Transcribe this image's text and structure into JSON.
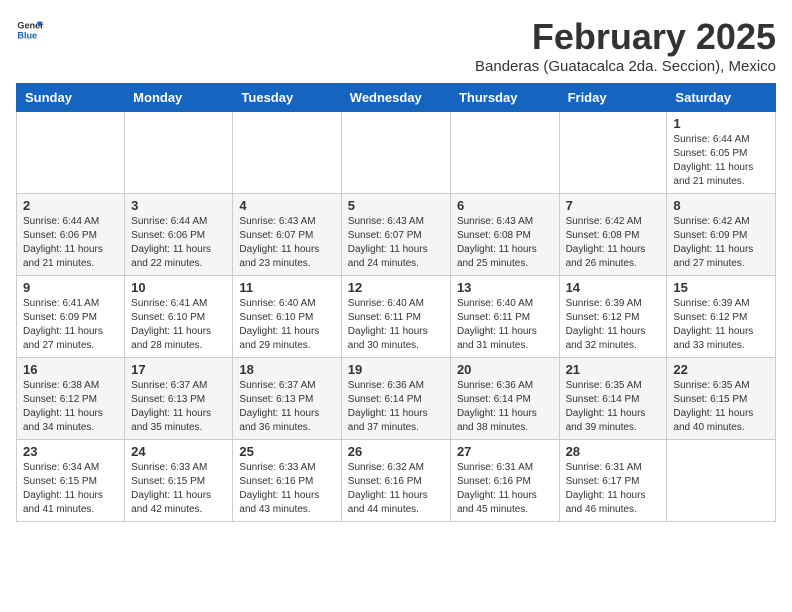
{
  "header": {
    "logo_general": "General",
    "logo_blue": "Blue",
    "title": "February 2025",
    "subtitle": "Banderas (Guatacalca 2da. Seccion), Mexico"
  },
  "weekdays": [
    "Sunday",
    "Monday",
    "Tuesday",
    "Wednesday",
    "Thursday",
    "Friday",
    "Saturday"
  ],
  "weeks": [
    {
      "days": [
        {
          "num": "",
          "empty": true
        },
        {
          "num": "",
          "empty": true
        },
        {
          "num": "",
          "empty": true
        },
        {
          "num": "",
          "empty": true
        },
        {
          "num": "",
          "empty": true
        },
        {
          "num": "",
          "empty": true
        },
        {
          "num": "1",
          "sunrise": "6:44 AM",
          "sunset": "6:05 PM",
          "daylight": "11 hours and 21 minutes."
        }
      ]
    },
    {
      "days": [
        {
          "num": "2",
          "sunrise": "6:44 AM",
          "sunset": "6:06 PM",
          "daylight": "11 hours and 21 minutes."
        },
        {
          "num": "3",
          "sunrise": "6:44 AM",
          "sunset": "6:06 PM",
          "daylight": "11 hours and 22 minutes."
        },
        {
          "num": "4",
          "sunrise": "6:43 AM",
          "sunset": "6:07 PM",
          "daylight": "11 hours and 23 minutes."
        },
        {
          "num": "5",
          "sunrise": "6:43 AM",
          "sunset": "6:07 PM",
          "daylight": "11 hours and 24 minutes."
        },
        {
          "num": "6",
          "sunrise": "6:43 AM",
          "sunset": "6:08 PM",
          "daylight": "11 hours and 25 minutes."
        },
        {
          "num": "7",
          "sunrise": "6:42 AM",
          "sunset": "6:08 PM",
          "daylight": "11 hours and 26 minutes."
        },
        {
          "num": "8",
          "sunrise": "6:42 AM",
          "sunset": "6:09 PM",
          "daylight": "11 hours and 27 minutes."
        }
      ]
    },
    {
      "days": [
        {
          "num": "9",
          "sunrise": "6:41 AM",
          "sunset": "6:09 PM",
          "daylight": "11 hours and 27 minutes."
        },
        {
          "num": "10",
          "sunrise": "6:41 AM",
          "sunset": "6:10 PM",
          "daylight": "11 hours and 28 minutes."
        },
        {
          "num": "11",
          "sunrise": "6:40 AM",
          "sunset": "6:10 PM",
          "daylight": "11 hours and 29 minutes."
        },
        {
          "num": "12",
          "sunrise": "6:40 AM",
          "sunset": "6:11 PM",
          "daylight": "11 hours and 30 minutes."
        },
        {
          "num": "13",
          "sunrise": "6:40 AM",
          "sunset": "6:11 PM",
          "daylight": "11 hours and 31 minutes."
        },
        {
          "num": "14",
          "sunrise": "6:39 AM",
          "sunset": "6:12 PM",
          "daylight": "11 hours and 32 minutes."
        },
        {
          "num": "15",
          "sunrise": "6:39 AM",
          "sunset": "6:12 PM",
          "daylight": "11 hours and 33 minutes."
        }
      ]
    },
    {
      "days": [
        {
          "num": "16",
          "sunrise": "6:38 AM",
          "sunset": "6:12 PM",
          "daylight": "11 hours and 34 minutes."
        },
        {
          "num": "17",
          "sunrise": "6:37 AM",
          "sunset": "6:13 PM",
          "daylight": "11 hours and 35 minutes."
        },
        {
          "num": "18",
          "sunrise": "6:37 AM",
          "sunset": "6:13 PM",
          "daylight": "11 hours and 36 minutes."
        },
        {
          "num": "19",
          "sunrise": "6:36 AM",
          "sunset": "6:14 PM",
          "daylight": "11 hours and 37 minutes."
        },
        {
          "num": "20",
          "sunrise": "6:36 AM",
          "sunset": "6:14 PM",
          "daylight": "11 hours and 38 minutes."
        },
        {
          "num": "21",
          "sunrise": "6:35 AM",
          "sunset": "6:14 PM",
          "daylight": "11 hours and 39 minutes."
        },
        {
          "num": "22",
          "sunrise": "6:35 AM",
          "sunset": "6:15 PM",
          "daylight": "11 hours and 40 minutes."
        }
      ]
    },
    {
      "days": [
        {
          "num": "23",
          "sunrise": "6:34 AM",
          "sunset": "6:15 PM",
          "daylight": "11 hours and 41 minutes."
        },
        {
          "num": "24",
          "sunrise": "6:33 AM",
          "sunset": "6:15 PM",
          "daylight": "11 hours and 42 minutes."
        },
        {
          "num": "25",
          "sunrise": "6:33 AM",
          "sunset": "6:16 PM",
          "daylight": "11 hours and 43 minutes."
        },
        {
          "num": "26",
          "sunrise": "6:32 AM",
          "sunset": "6:16 PM",
          "daylight": "11 hours and 44 minutes."
        },
        {
          "num": "27",
          "sunrise": "6:31 AM",
          "sunset": "6:16 PM",
          "daylight": "11 hours and 45 minutes."
        },
        {
          "num": "28",
          "sunrise": "6:31 AM",
          "sunset": "6:17 PM",
          "daylight": "11 hours and 46 minutes."
        },
        {
          "num": "",
          "empty": true
        }
      ]
    }
  ],
  "labels": {
    "sunrise_prefix": "Sunrise: ",
    "sunset_prefix": "Sunset: ",
    "daylight_prefix": "Daylight: "
  }
}
